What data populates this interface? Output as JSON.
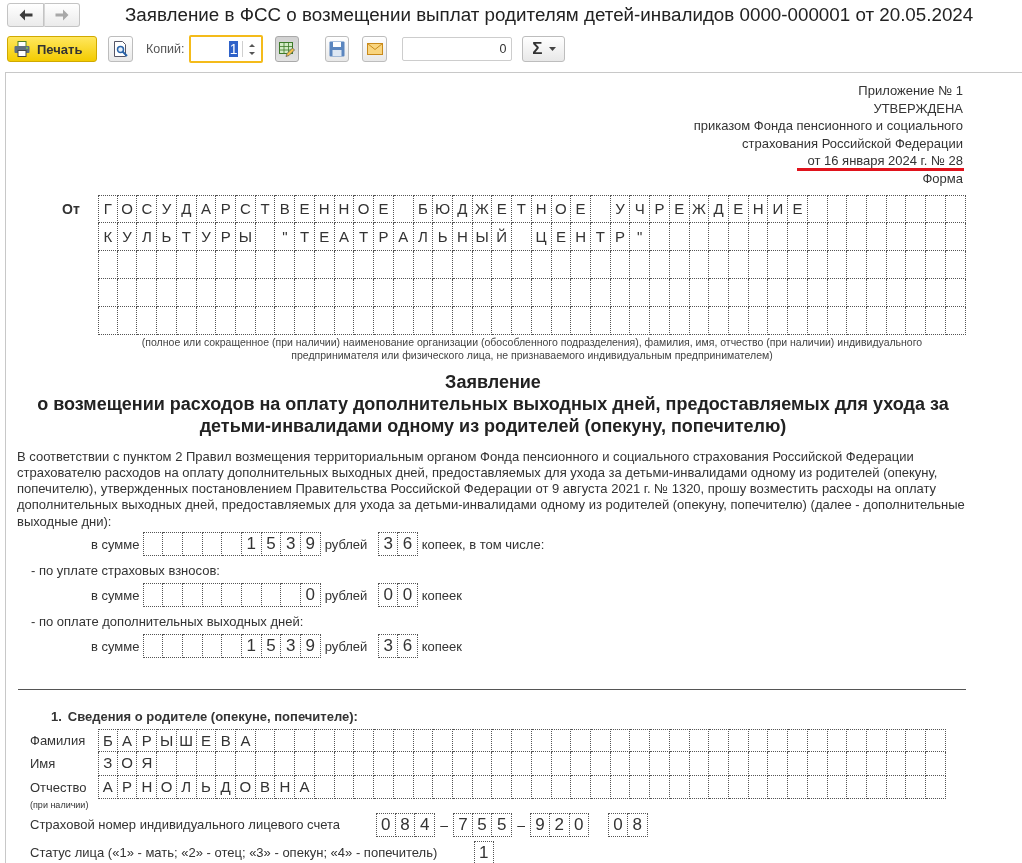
{
  "window": {
    "title": "Заявление в ФСС о возмещении выплат родителям детей-инвалидов 0000-000001 от 20.05.2024"
  },
  "nav_buttons": [
    {
      "kind": "back",
      "disabled": false
    },
    {
      "kind": "forward",
      "disabled": true
    }
  ],
  "toolbar": {
    "print_button": {
      "label": "Печать"
    },
    "copies": {
      "label": "Копий:",
      "value": "1",
      "focused": true
    },
    "table_edit_button": {
      "on": true
    },
    "counter": {
      "value": "0"
    },
    "sum_button": {
      "label": "Σ"
    }
  },
  "header_note": {
    "lines": [
      {
        "text": "Приложение № 1",
        "underlined": false
      },
      {
        "text": "УТВЕРЖДЕНА",
        "underlined": false
      },
      {
        "text": "приказом Фонда пенсионного и социального",
        "underlined": false
      },
      {
        "text": "страхования Российской Федерации",
        "underlined": false
      },
      {
        "text": "от 16 января 2024 г. № 28",
        "underlined": true
      },
      {
        "text": "Форма",
        "underlined": false
      }
    ]
  },
  "from": {
    "label": "От",
    "rows": [
      {
        "value": "Г О С У Д А Р С Т В Е Н Н О Е  Б Ю Д Ж Е Т Н О Е  У Ч Р Е Ж Д Е Н И Е"
      },
      {
        "value": "К У Л Ь Т У Р Ы  \" Т Е А Т Р А Л Ь Н Ы Й  Ц Е Н Т Р \""
      },
      {},
      {},
      {}
    ],
    "caption": "(полное или сокращенное (при наличии) наименование организации (обособленного подразделения), фамилия, имя, отчество (при наличии) индивидуального предпринимателя или физического лица, не признаваемого индивидуальным предпринимателем)"
  },
  "statement": {
    "title": "Заявление",
    "subtitle": "о возмещении расходов на оплату дополнительных выходных дней, предоставляемых для ухода за детьми-инвалидами одному из родителей (опекуну, попечителю)",
    "intro": "В соответствии с пунктом 2 Правил возмещения территориальным органом Фонда пенсионного и социального страхования Российской Федерации страхователю расходов на оплату дополнительных выходных дней, предоставляемых для ухода за детьми-инвалидами одному из родителей (опекуну, попечителю), утвержденных постановлением Правительства Российской Федерации от 9 августа 2021 г. № 1320, прошу возместить расходы на оплату дополнительных выходных дней, предоставляемых для ухода за детьми-инвалидами одному из родителей (опекуну, попечителю) (далее - дополнительные выходные дни):"
  },
  "sums": [
    {
      "kind": "sum",
      "label": "в сумме",
      "rubles": "1 5 3 9",
      "rubles_unit": "рублей",
      "kopecks": "3 6",
      "kopecks_unit": "копеек, в том числе:"
    },
    {
      "kind": "note",
      "text": "- по уплате страховых взносов:"
    },
    {
      "kind": "sum",
      "label": "в сумме",
      "rubles": "0",
      "rubles_unit": "рублей",
      "kopecks": "0 0",
      "kopecks_unit": "копеек"
    },
    {
      "kind": "note",
      "text": "- по оплате дополнительных выходных дней:"
    },
    {
      "kind": "sum",
      "label": "в сумме",
      "rubles": "1 5 3 9",
      "rubles_unit": "рублей",
      "kopecks": "3 6",
      "kopecks_unit": "копеек"
    }
  ],
  "section_1": {
    "number": "1.",
    "title": "Сведения о родителе (опекуне, попечителе):",
    "fields": [
      {
        "label": "Фамилия",
        "value": "Б А Р Ы Ш Е В А"
      },
      {
        "label": "Имя",
        "value": "З О Я"
      },
      {
        "label": "Отчество",
        "value": "А Р Н О Л Ь Д О В Н А",
        "note": "(при наличии)"
      }
    ],
    "snils": {
      "label": "Страховой номер индивидуального лицевого счета",
      "parts": [
        {
          "kind": "comb",
          "value": "0 8 4"
        },
        {
          "kind": "separator",
          "value": "–"
        },
        {
          "kind": "comb",
          "value": "7 5 5"
        },
        {
          "kind": "separator",
          "value": "–"
        },
        {
          "kind": "comb",
          "value": "9 2 0"
        },
        {
          "kind": "comb",
          "value": "0 8"
        }
      ]
    },
    "status": {
      "label": "Статус лица («1» - мать; «2» - отец; «3» - опекун; «4» - попечитель)",
      "value": "1"
    }
  }
}
